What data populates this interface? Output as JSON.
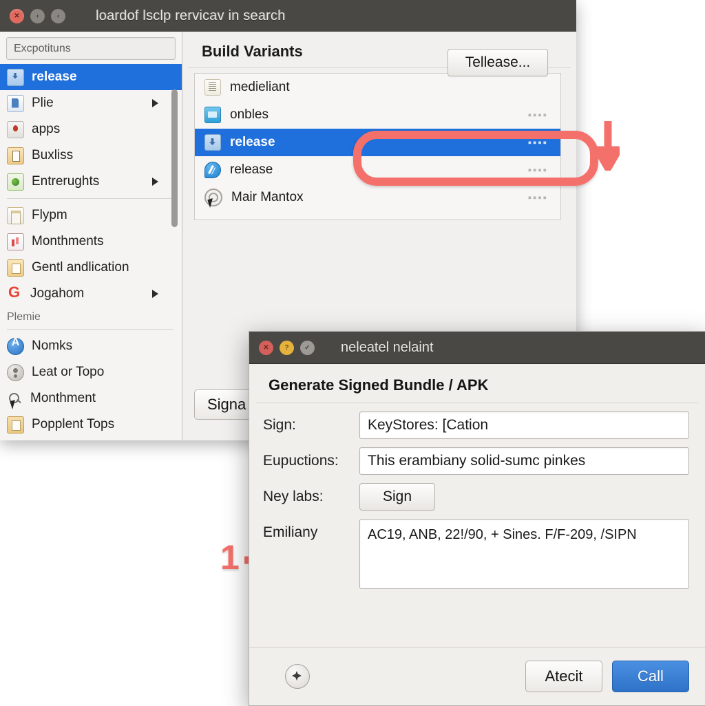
{
  "main_window": {
    "title": "loardof lsclp rervicav in search",
    "traffic_lights": [
      {
        "name": "close",
        "glyph": "✕",
        "color": "#e06a5e"
      },
      {
        "name": "minimize",
        "glyph": "‹",
        "color": "#8a8782"
      },
      {
        "name": "zoom",
        "glyph": "‹",
        "color": "#8a8782"
      }
    ]
  },
  "sidebar": {
    "search_value": "Excpotituns",
    "items": [
      {
        "label": "release",
        "icon": "release-icon",
        "selected": true,
        "caret": false
      },
      {
        "label": "Plie",
        "icon": "file-blue-icon",
        "selected": false,
        "caret": true
      },
      {
        "label": "apps",
        "icon": "apps-icon",
        "selected": false,
        "caret": false
      },
      {
        "label": "Buxliss",
        "icon": "document-tan-icon",
        "selected": false,
        "caret": false
      },
      {
        "label": "Entrerughts",
        "icon": "globe-green-icon",
        "selected": false,
        "caret": true
      },
      {
        "label": "Flypm",
        "icon": "clipboard-icon",
        "selected": false,
        "caret": false
      },
      {
        "label": "Monthments",
        "icon": "chart-red-icon",
        "selected": false,
        "caret": false
      },
      {
        "label": "Gentl andlication",
        "icon": "folder-tan-icon",
        "selected": false,
        "caret": false
      },
      {
        "label": "Jogahom",
        "icon": "google-icon",
        "selected": false,
        "caret": true
      }
    ],
    "group_label": "Plemie",
    "items2": [
      {
        "label": "Nomks",
        "icon": "letter-a-blue-icon"
      },
      {
        "label": "Leat or Topo",
        "icon": "person-gray-icon"
      },
      {
        "label": "Monthment",
        "icon": "search-icon"
      },
      {
        "label": "Popplent Tops",
        "icon": "folder-open-icon"
      }
    ]
  },
  "content": {
    "header": "Build Variants",
    "tellease_button": "Tellease...",
    "signa_button": "Signa",
    "row_handle_dots": "▪▪▪▪",
    "rows": [
      {
        "label": "medieliant",
        "icon": "spreadsheet-icon",
        "selected": false,
        "dots": false
      },
      {
        "label": "onbles",
        "icon": "window-blue-icon",
        "selected": false,
        "dots": true
      },
      {
        "label": "release",
        "icon": "release-icon",
        "selected": true,
        "dots": true
      },
      {
        "label": "release",
        "icon": "tools-blue-icon",
        "selected": false,
        "dots": true
      },
      {
        "label": "Mair Mantox",
        "icon": "target-gray-icon",
        "selected": false,
        "dots": true
      }
    ]
  },
  "annotations": {
    "color": "#f4706a",
    "oval_name": "highlight-oval",
    "arrow_down_name": "callout-arrow-down",
    "arrow_right_name": "callout-arrow-right",
    "step_number": "1"
  },
  "dialog": {
    "title": "neleatel nelaint",
    "heading": "Generate Signed Bundle / APK",
    "traffic_lights": [
      {
        "name": "close",
        "glyph": "✕",
        "color": "#d4605c"
      },
      {
        "name": "minimize",
        "glyph": "?",
        "color": "#e5b23c"
      },
      {
        "name": "zoom",
        "glyph": "✓",
        "color": "#9d9a95"
      }
    ],
    "fields": [
      {
        "label": "Sign:",
        "value": "KeyStores: [Cation",
        "type": "input"
      },
      {
        "label": "Eupuctions:",
        "value": "This erambiany solid-sumc pinkes",
        "type": "input"
      },
      {
        "label": "Ney labs:",
        "value": "Sign",
        "type": "button"
      },
      {
        "label": "Emiliany",
        "value": "AC19, ANB, 22!/90,  + Sines. F/F-209, /SIPN",
        "type": "textarea"
      }
    ],
    "help_icon": "help-compass-icon",
    "cancel_button": "Atecit",
    "confirm_button": "Call"
  }
}
